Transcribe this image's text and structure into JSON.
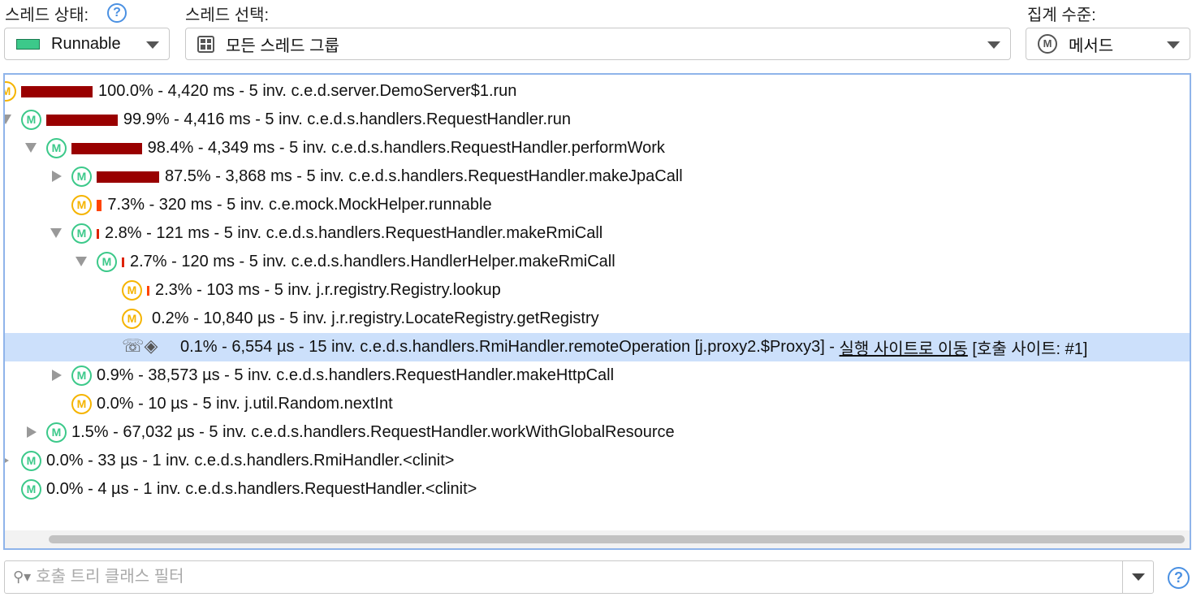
{
  "header": {
    "thread_state_label": "스레드 상태:",
    "thread_state_value": "Runnable",
    "thread_state_color": "#3cc98a",
    "thread_select_label": "스레드 선택:",
    "thread_select_value": "모든 스레드 그룹",
    "aggregation_label": "집계 수준:",
    "aggregation_value": "메서드",
    "aggregation_icon_letter": "M"
  },
  "tree": {
    "rows": [
      {
        "level": 0,
        "expander": "none",
        "icon": "method-orange",
        "bar": 100.0,
        "bar_color": "#990000",
        "text": "100.0% - 4,420 ms - 5 inv. c.e.d.server.DemoServer$1.run"
      },
      {
        "level": 1,
        "expander": "open",
        "icon": "method-green",
        "bar": 99.9,
        "bar_color": "#990000",
        "text": "99.9% - 4,416 ms - 5 inv. c.e.d.s.handlers.RequestHandler.run"
      },
      {
        "level": 2,
        "expander": "open",
        "icon": "method-green",
        "bar": 98.4,
        "bar_color": "#990000",
        "text": "98.4% - 4,349 ms - 5 inv. c.e.d.s.handlers.RequestHandler.performWork"
      },
      {
        "level": 3,
        "expander": "closed",
        "icon": "method-green",
        "bar": 87.5,
        "bar_color": "#990000",
        "text": "87.5% - 3,868 ms - 5 inv. c.e.d.s.handlers.RequestHandler.makeJpaCall"
      },
      {
        "level": 3,
        "expander": "none",
        "icon": "method-orange",
        "bar": 7.3,
        "bar_color": "#ff4400",
        "text": "7.3% - 320 ms - 5 inv. c.e.mock.MockHelper.runnable"
      },
      {
        "level": 3,
        "expander": "open",
        "icon": "method-green",
        "bar": 2.8,
        "bar_color": "#dd2200",
        "text": "2.8% - 121 ms - 5 inv. c.e.d.s.handlers.RequestHandler.makeRmiCall"
      },
      {
        "level": 4,
        "expander": "open",
        "icon": "method-green",
        "bar": 2.7,
        "bar_color": "#dd2200",
        "text": "2.7% - 120 ms - 5 inv. c.e.d.s.handlers.HandlerHelper.makeRmiCall"
      },
      {
        "level": 5,
        "expander": "none",
        "icon": "method-orange",
        "bar": 2.3,
        "bar_color": "#ff4400",
        "text": "2.3% - 103 ms - 5 inv. j.r.registry.Registry.lookup"
      },
      {
        "level": 5,
        "expander": "none",
        "icon": "method-orange",
        "bar": 0.2,
        "bar_color": "#ff4400",
        "text": "0.2% - 10,840 µs - 5 inv. j.r.registry.LocateRegistry.getRegistry"
      },
      {
        "level": 5,
        "expander": "none",
        "icon": "rmi-call",
        "bar": 0,
        "bar_color": "",
        "text": "0.1% - 6,554 µs - 15 inv. c.e.d.s.handlers.RmiHandler.remoteOperation [j.proxy2.$Proxy3] - ",
        "link": "실행 사이트로 이동",
        "suffix": " [호출 사이트: #1]",
        "selected": true
      },
      {
        "level": 3,
        "expander": "closed",
        "icon": "method-green",
        "bar": 0,
        "bar_color": "",
        "text": "0.9% - 38,573 µs - 5 inv. c.e.d.s.handlers.RequestHandler.makeHttpCall"
      },
      {
        "level": 3,
        "expander": "none",
        "icon": "method-orange",
        "bar": 0,
        "bar_color": "",
        "text": "0.0% - 10 µs - 5 inv. j.util.Random.nextInt"
      },
      {
        "level": 2,
        "expander": "closed",
        "icon": "method-green",
        "bar": 0,
        "bar_color": "",
        "text": "1.5% - 67,032 µs - 5 inv. c.e.d.s.handlers.RequestHandler.workWithGlobalResource"
      },
      {
        "level": 1,
        "expander": "closed-small",
        "icon": "method-green",
        "bar": 0,
        "bar_color": "",
        "text": "0.0% - 33 µs - 1 inv. c.e.d.s.handlers.RmiHandler.<clinit>"
      },
      {
        "level": 1,
        "expander": "none",
        "icon": "method-green",
        "bar": 0,
        "bar_color": "",
        "text": "0.0% - 4 µs - 1 inv. c.e.d.s.handlers.RequestHandler.<clinit>"
      }
    ]
  },
  "filter": {
    "placeholder": "호출 트리 클래스 필터",
    "value": ""
  },
  "help_glyph": "?"
}
